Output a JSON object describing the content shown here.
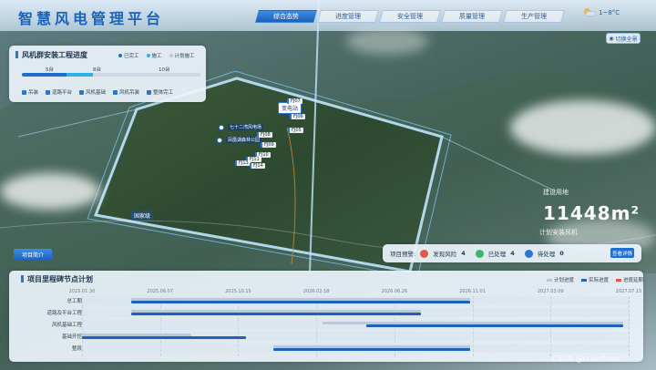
{
  "header": {
    "title": "智慧风电管理平台",
    "tabs": [
      {
        "label": "综合态势",
        "active": true
      },
      {
        "label": "进度管理",
        "active": false
      },
      {
        "label": "安全管理",
        "active": false
      },
      {
        "label": "质量管理",
        "active": false
      },
      {
        "label": "生产管理",
        "active": false
      }
    ],
    "weather": "1~8°C",
    "tag_button": "切换全景"
  },
  "progress_panel": {
    "title": "风机群安装工程进度",
    "legend": [
      "已完工",
      "施工",
      "计划施工"
    ],
    "scale": [
      "5台",
      "8台",
      "10台"
    ],
    "categories": [
      "吊装",
      "道路平台",
      "风机基础",
      "风机吊装",
      "整体完工"
    ],
    "completed_fraction": 0.25,
    "in_progress_fraction": 0.15
  },
  "map": {
    "station": "变电站",
    "labels": [
      "七十二湾风电场",
      "凤凰湖森林公园"
    ],
    "project_tag": "国家级",
    "turbines": [
      "FJ07",
      "FJ06",
      "FJ05",
      "FJ08",
      "FJ09",
      "FJ10",
      "FJ11",
      "FJ13",
      "FJ14"
    ],
    "intro_button": "项目简介",
    "stat_caption": "建设用地",
    "stat_value": "11448m²",
    "stat_caption2": "计划安装风机"
  },
  "alerts": {
    "label": "项目预警:",
    "items": [
      {
        "label": "发现风险",
        "count": "4",
        "color": "#e05a4a"
      },
      {
        "label": "已处理",
        "count": "4",
        "color": "#43b36b"
      },
      {
        "label": "待处理",
        "count": "0",
        "color": "#2a76d2"
      }
    ],
    "button": "查看详情"
  },
  "gantt": {
    "title": "项目里程碑节点计划",
    "legend": [
      {
        "label": "计划进度",
        "color": "#b9c8da"
      },
      {
        "label": "实际进度",
        "color": "#1f62b8"
      },
      {
        "label": "进度延期",
        "color": "#e05a4a"
      }
    ],
    "dates": [
      "2025.01.30",
      "2025.06.07",
      "2025.10.15",
      "2026.02.18",
      "2026.06.26",
      "2026.11.01",
      "2027.03.09",
      "2027.07.15"
    ],
    "rows": [
      {
        "label": "总工期",
        "plan": [
          0.09,
          0.71
        ],
        "actual": [
          0.09,
          0.71
        ]
      },
      {
        "label": "道路及平台工程",
        "plan": [
          0.09,
          0.62
        ],
        "actual": [
          0.09,
          0.62
        ]
      },
      {
        "label": "风机基础工程",
        "plan": [
          0.44,
          0.99
        ],
        "actual": [
          0.52,
          0.99
        ]
      },
      {
        "label": "基础开挖",
        "plan": [
          0.0,
          0.2
        ],
        "actual": [
          0.0,
          0.3
        ]
      },
      {
        "label": "整段",
        "plan": [
          0.35,
          0.71
        ],
        "actual": [
          0.35,
          0.71
        ]
      }
    ]
  },
  "watermark": "CSDN @undefined"
}
